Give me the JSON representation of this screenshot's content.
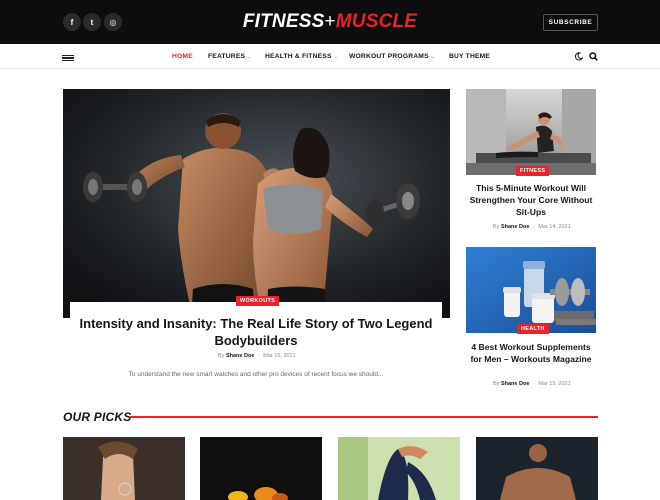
{
  "header": {
    "logo_part1": "FITNESS",
    "logo_plus": "+",
    "logo_part2": "MUSCLE",
    "subscribe_label": "SUBSCRIBE",
    "social_icons": [
      "facebook-icon",
      "twitter-icon",
      "instagram-icon"
    ],
    "social_glyphs": [
      "f",
      "t",
      "◎"
    ]
  },
  "nav": {
    "items": [
      {
        "label": "HOME",
        "active": true,
        "dropdown": false
      },
      {
        "label": "FEATURES",
        "active": false,
        "dropdown": true
      },
      {
        "label": "HEALTH & FITNESS",
        "active": false,
        "dropdown": true
      },
      {
        "label": "WORKOUT PROGRAMS",
        "active": false,
        "dropdown": true
      },
      {
        "label": "BUY THEME",
        "active": false,
        "dropdown": false
      }
    ],
    "caret_glyph": "⌄",
    "icons": [
      "hamburger-menu-icon",
      "dark-mode-moon-icon",
      "search-icon"
    ]
  },
  "featured": {
    "category": "WORKOUTS",
    "title": "Intensity and Insanity: The Real Life Story of Two Legend Bodybuilders",
    "by_label": "By",
    "author": "Shane Doe",
    "separator": "-",
    "date": "Mar 15, 2021",
    "excerpt": "To understand the new smart watches and other pro devices of recent focus we should..."
  },
  "side_posts": [
    {
      "category": "FITNESS",
      "title": "This 5-Minute Workout Will Strengthen Your Core Without Sit-Ups",
      "by_label": "By",
      "author": "Shane Doe",
      "separator": "-",
      "date": "Mar 14, 2021"
    },
    {
      "category": "HEALTH",
      "title": "4 Best Workout Supplements for Men – Workouts Magazine",
      "by_label": "By",
      "author": "Shane Doe",
      "separator": "-",
      "date": "Mar 13, 2021"
    }
  ],
  "picks": {
    "heading": "OUR PICKS",
    "count": 4
  },
  "colors": {
    "accent": "#e8232a",
    "topbar": "#0d0d0d",
    "text": "#161616"
  }
}
